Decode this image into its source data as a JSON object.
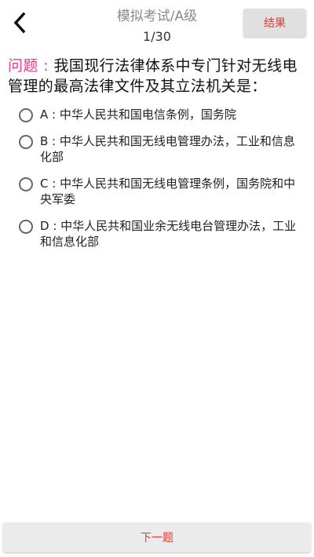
{
  "header": {
    "back_icon": "chevron-left-icon",
    "title": "模拟考试/A级",
    "counter": "1/30",
    "result_label": "结果"
  },
  "question": {
    "prefix": "问题 : ",
    "text": "我国现行法律体系中专门针对无线电管理的最高法律文件及其立法机关是："
  },
  "options": [
    {
      "label": "A : 中华人民共和国电信条例，国务院"
    },
    {
      "label": "B : 中华人民共和国无线电管理办法，工业和信息化部"
    },
    {
      "label": "C : 中华人民共和国无线电管理条例，国务院和中央军委"
    },
    {
      "label": "D : 中华人民共和国业余无线电台管理办法，工业和信息化部"
    }
  ],
  "footer": {
    "next_label": "下一题"
  },
  "colors": {
    "accent_red": "#e53935",
    "question_prefix": "#e0408a"
  }
}
